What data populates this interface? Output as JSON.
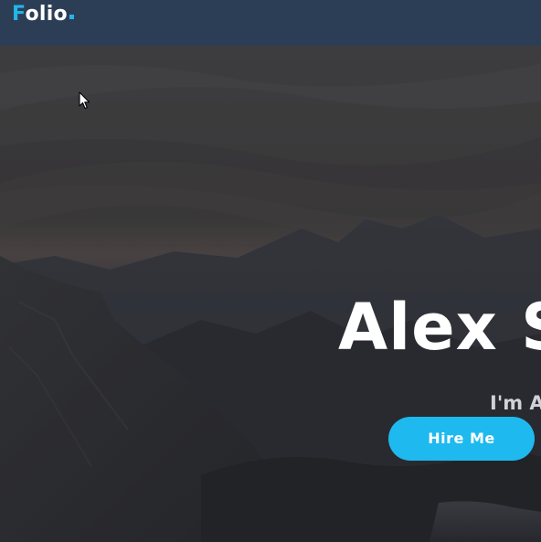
{
  "navbar": {
    "logo_first": "F",
    "logo_rest": "olio"
  },
  "hero": {
    "title": "Alex S",
    "subtitle": "I'm A",
    "button_label": "Hire Me"
  },
  "colors": {
    "accent": "#23b5ea",
    "navbar_bg": "#2c3e55",
    "button_bg": "#1eb9ef"
  },
  "icons": {
    "cursor": "mouse-pointer-icon"
  }
}
